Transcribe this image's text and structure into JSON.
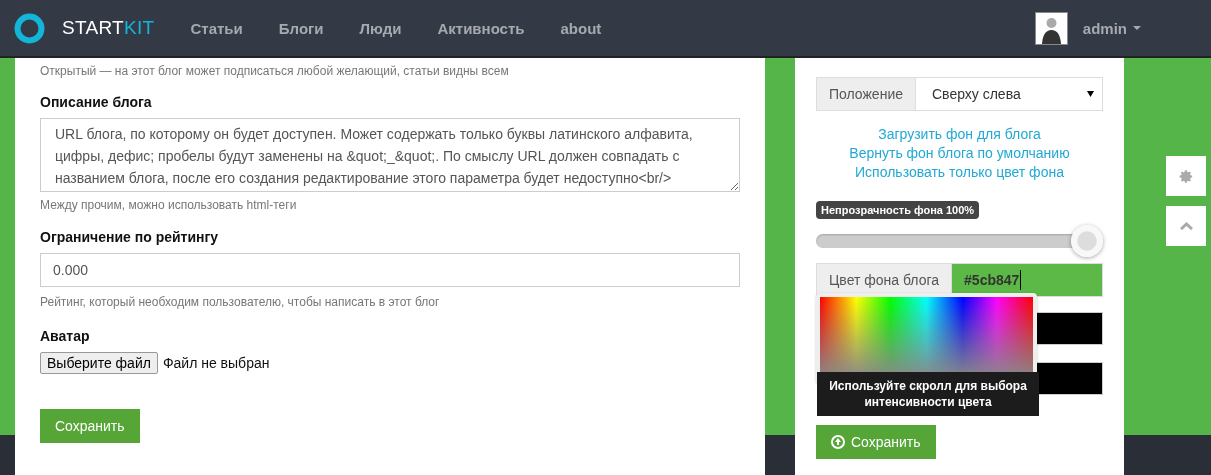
{
  "navbar": {
    "logo": {
      "part_1": "START",
      "part_2": "KIT"
    },
    "links": [
      {
        "label": "Статьи"
      },
      {
        "label": "Блоги"
      },
      {
        "label": "Люди"
      },
      {
        "label": "Активность"
      },
      {
        "label": "about"
      }
    ],
    "user": {
      "name": "admin"
    }
  },
  "form": {
    "type_help": "Открытый — на этот блог может подписаться любой желающий, статьи видны всем",
    "description": {
      "label": "Описание блога",
      "value": "URL блога, по которому он будет доступен. Может содержать только буквы латинского алфавита, цифры, дефис; пробелы будут заменены на &quot;_&quot;. По смыслу URL должен совпадать с названием блога, после его создания редактирование этого параметра будет недоступно<br/>",
      "help": "Между прочим, можно использовать html-теги"
    },
    "rating": {
      "label": "Ограничение по рейтингу",
      "value": "0.000",
      "help": "Рейтинг, который необходим пользователю, чтобы написать в этот блог"
    },
    "avatar": {
      "label": "Аватар",
      "button": "Выберите файл",
      "status": "Файл не выбран"
    },
    "save": "Сохранить"
  },
  "background": {
    "position": {
      "label": "Положение",
      "value": "Сверху слева"
    },
    "links": [
      "Загрузить фон для блога",
      "Вернуть фон блога по умолчанию",
      "Использовать только цвет фона"
    ],
    "opacity": {
      "label": "Непрозрачность фона 100%",
      "level": 1
    },
    "color": {
      "label": "Цвет фона блога",
      "value": "#5cb847"
    },
    "picker_tooltip": "Используйте скролл для выбора интенсивности цвета",
    "save": "Сохранить"
  }
}
